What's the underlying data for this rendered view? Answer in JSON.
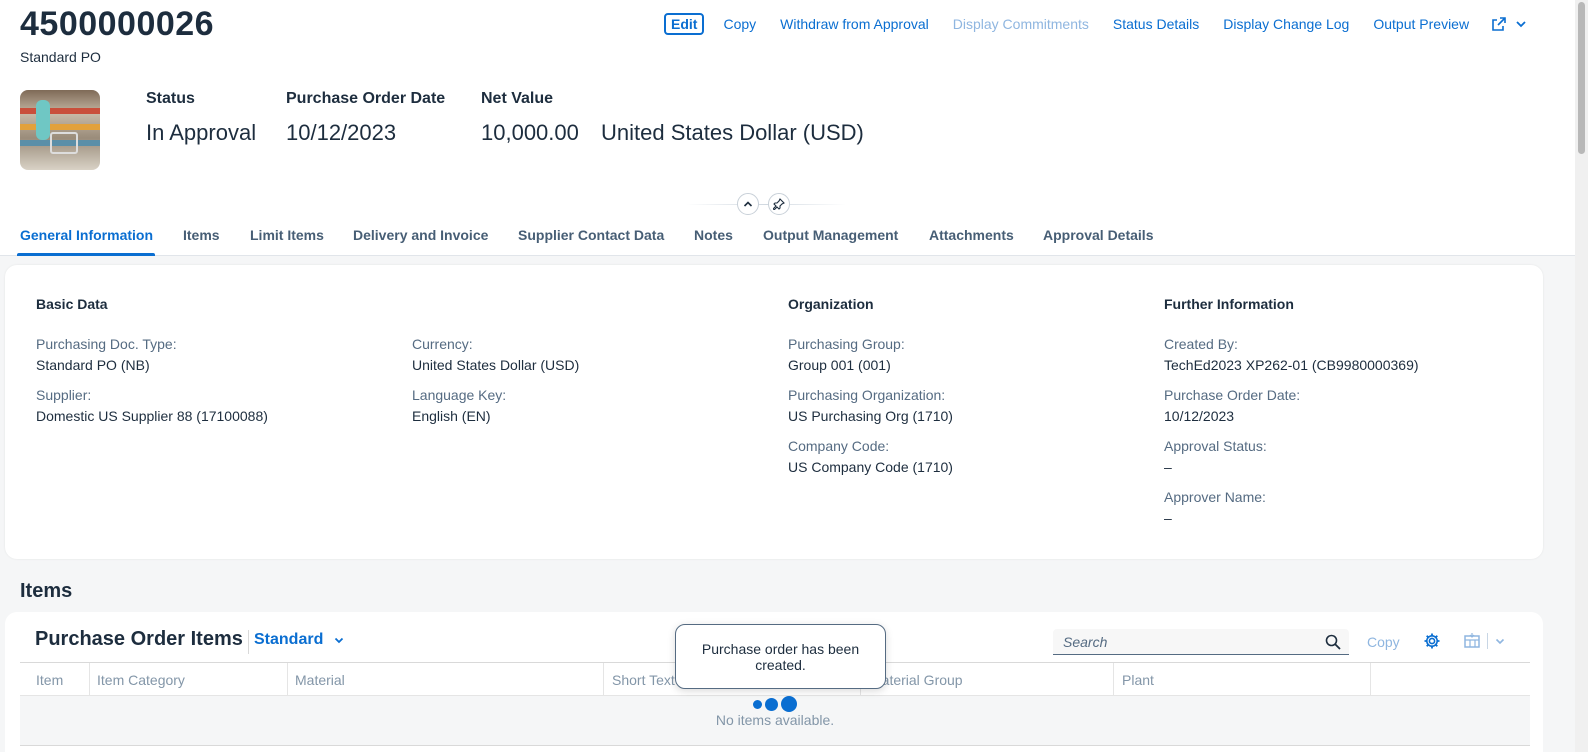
{
  "header": {
    "title": "4500000026",
    "subtitle": "Standard PO",
    "actions": [
      {
        "label": "Edit"
      },
      {
        "label": "Copy"
      },
      {
        "label": "Withdraw from Approval"
      },
      {
        "label": "Display Commitments"
      },
      {
        "label": "Status Details"
      },
      {
        "label": "Display Change Log"
      },
      {
        "label": "Output Preview"
      }
    ],
    "share_icon": "share-icon",
    "kpis": {
      "status": {
        "label": "Status",
        "value": "In Approval"
      },
      "po_date": {
        "label": "Purchase Order Date",
        "value": "10/12/2023"
      },
      "net_value": {
        "label": "Net Value",
        "value": "10,000.00",
        "currency": "United States Dollar (USD)"
      }
    }
  },
  "tabs": [
    {
      "label": "General Information",
      "active": true
    },
    {
      "label": "Items"
    },
    {
      "label": "Limit Items"
    },
    {
      "label": "Delivery and Invoice"
    },
    {
      "label": "Supplier Contact Data"
    },
    {
      "label": "Notes"
    },
    {
      "label": "Output Management"
    },
    {
      "label": "Attachments"
    },
    {
      "label": "Approval Details"
    }
  ],
  "general": {
    "basic_data": {
      "title": "Basic Data",
      "doc_type": {
        "label": "Purchasing Doc. Type:",
        "value": "Standard PO (NB)"
      },
      "supplier": {
        "label": "Supplier:",
        "value": "Domestic US Supplier 88 (17100088)"
      },
      "currency": {
        "label": "Currency:",
        "value": "United States Dollar (USD)"
      },
      "language": {
        "label": "Language Key:",
        "value": "English (EN)"
      }
    },
    "organization": {
      "title": "Organization",
      "purch_group": {
        "label": "Purchasing Group:",
        "value": "Group 001 (001)"
      },
      "purch_org": {
        "label": "Purchasing Organization:",
        "value": "US Purchasing Org (1710)"
      },
      "company_code": {
        "label": "Company Code:",
        "value": "US Company Code (1710)"
      }
    },
    "further": {
      "title": "Further Information",
      "created_by": {
        "label": "Created By:",
        "value": "TechEd2023 XP262-01 (CB9980000369)"
      },
      "po_date": {
        "label": "Purchase Order Date:",
        "value": "10/12/2023"
      },
      "approval_status": {
        "label": "Approval Status:",
        "value": "–"
      },
      "approver": {
        "label": "Approver Name:",
        "value": "–"
      }
    }
  },
  "items_section": {
    "heading": "Items",
    "table_title": "Purchase Order Items",
    "variant": "Standard",
    "search_placeholder": "Search",
    "copy_label": "Copy",
    "columns": [
      "Item",
      "Item Category",
      "Material",
      "Short Text",
      "Material Group",
      "Plant"
    ],
    "empty_text": "No items available."
  },
  "toast": {
    "message": "Purchase order has been created."
  },
  "colors": {
    "accent": "#0a6ed1",
    "text": "#1d2d3e",
    "label": "#556b82",
    "disabled": "#8fb6e0"
  }
}
